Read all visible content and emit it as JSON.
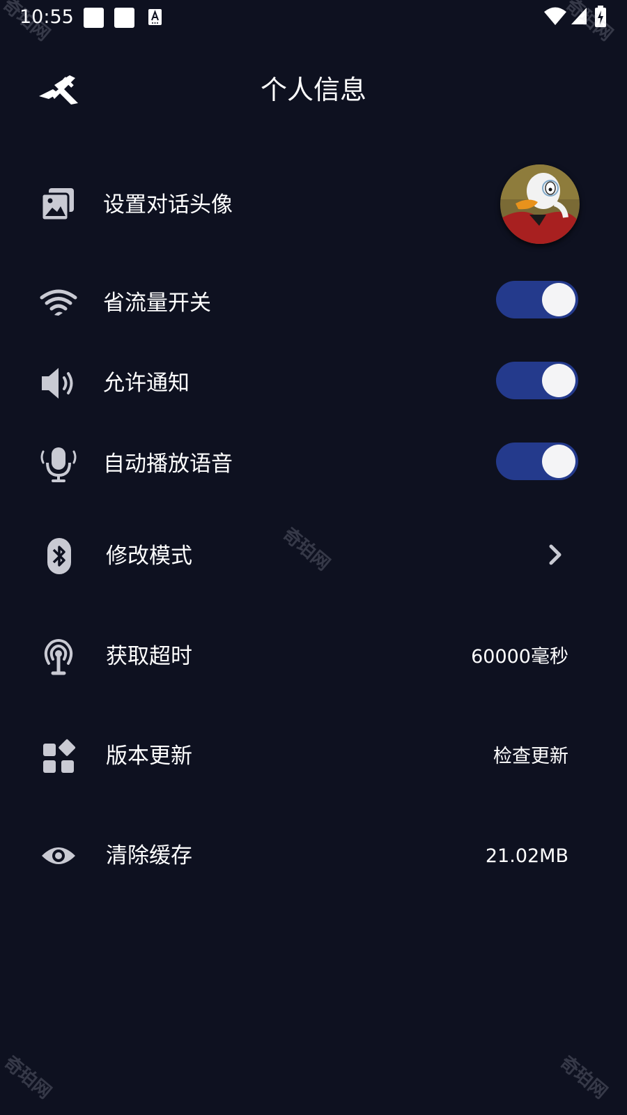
{
  "status_bar": {
    "time": "10:55",
    "notification_icons": [
      "app-square-icon",
      "app-square-icon",
      "a-text-icon"
    ],
    "right_icons": [
      "wifi-icon",
      "signal-icon",
      "battery-charging-icon"
    ]
  },
  "header": {
    "title": "个人信息",
    "back_icon": "back-icon"
  },
  "settings": {
    "avatar": {
      "label": "设置对话头像",
      "icon": "image-stack-icon"
    },
    "data_saver": {
      "label": "省流量开关",
      "icon": "wifi-icon",
      "enabled": true
    },
    "notifications": {
      "label": "允许通知",
      "icon": "speaker-icon",
      "enabled": true
    },
    "auto_voice": {
      "label": "自动播放语音",
      "icon": "microphone-icon",
      "enabled": true
    },
    "mode": {
      "label": "修改模式",
      "icon": "bluetooth-icon",
      "action_icon": "chevron-right-icon"
    },
    "timeout": {
      "label": "获取超时",
      "value": "60000毫秒",
      "icon": "antenna-icon"
    },
    "update": {
      "label": "版本更新",
      "value": "检查更新",
      "icon": "apps-grid-icon"
    },
    "cache": {
      "label": "清除缓存",
      "value": "21.02MB",
      "icon": "eye-icon"
    }
  },
  "watermark": "奇珀网",
  "colors": {
    "background": "#0e1120",
    "toggle_on": "#243a8c",
    "toggle_knob": "#f4f4f6",
    "icon": "#c9cad3"
  }
}
